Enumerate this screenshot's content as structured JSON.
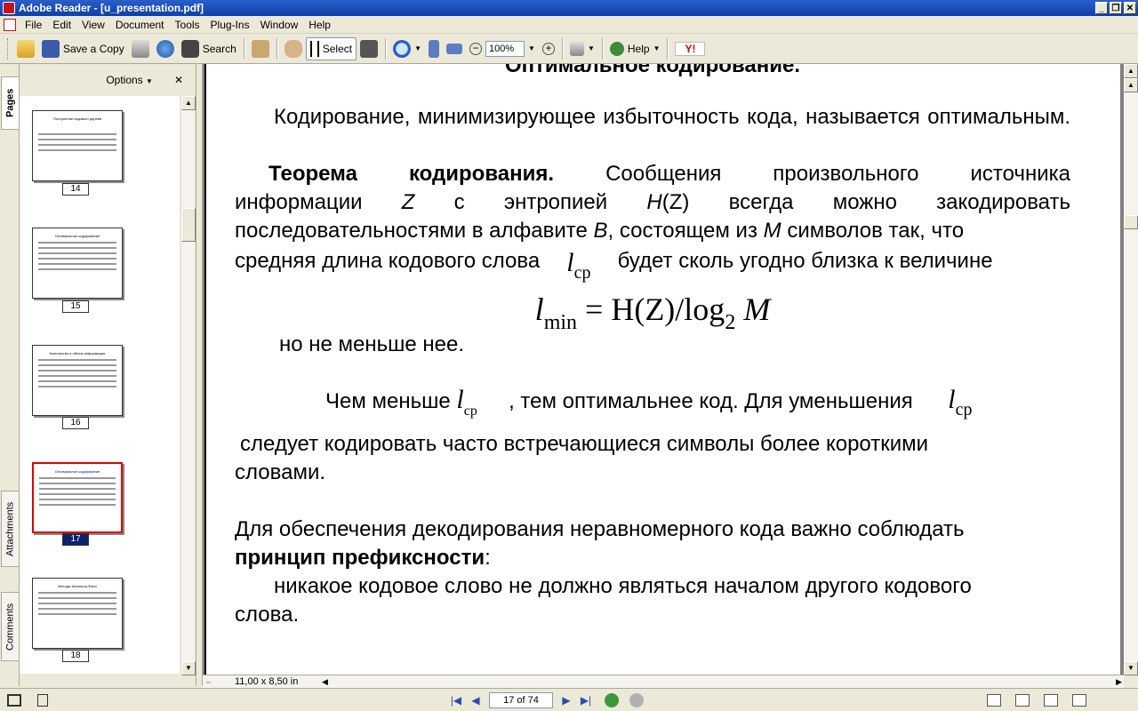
{
  "window": {
    "title": "Adobe Reader - [u_presentation.pdf]",
    "min": "_",
    "restore": "❐",
    "close": "✕"
  },
  "menu": {
    "items": [
      "File",
      "Edit",
      "View",
      "Document",
      "Tools",
      "Plug-Ins",
      "Window",
      "Help"
    ]
  },
  "toolbar": {
    "save_copy": "Save a Copy",
    "search": "Search",
    "select": "Select",
    "zoom_value": "100%",
    "help": "Help",
    "yahoo": "Y!"
  },
  "nav_tabs": {
    "pages": "Pages",
    "attachments": "Attachments",
    "comments": "Comments"
  },
  "pane": {
    "options": "Options",
    "close": "✕",
    "thumbnails": [
      {
        "num": "14",
        "title": "Построение кодового дерева"
      },
      {
        "num": "15",
        "title": "Оптимальное кодирование"
      },
      {
        "num": "16",
        "title": "Количество и объем информации"
      },
      {
        "num": "17",
        "title": "Оптимальное кодирование"
      },
      {
        "num": "18",
        "title": "Методы Шеннона-Фано"
      }
    ],
    "selected_page": "17"
  },
  "document": {
    "heading_partial": "Оптимальное кодирование.",
    "p1": "Кодирование, минимизирующее избыточность кода, называется оптимальным.",
    "theorem_bold": "Теорема кодирования.",
    "theorem_line1": "Сообщения произвольного источника",
    "theorem_line2_a": "информации",
    "theorem_Z": "Z",
    "theorem_line2_b": "с энтропией",
    "theorem_H": "H",
    "theorem_Zp": "(Z)",
    "theorem_line2_c": "всегда можно закодировать",
    "theorem_line3_a": "последовательностями в алфавите",
    "theorem_B": "B",
    "theorem_line3_b": ", состоящем из",
    "theorem_M": "M",
    "theorem_line3_c": "символов так, что",
    "theorem_line4_a": "средняя длина кодового слова",
    "l": "l",
    "cp": "ср",
    "theorem_line4_b": "будет сколь угодно близка к величине",
    "formula_l": "l",
    "formula_min": "min",
    "formula_eq": " = H(Z)/log",
    "formula_2": "2",
    "formula_M": " M",
    "but_not_less": "но не меньше нее.",
    "smaller_a": "Чем меньше",
    "smaller_b": ", тем оптимальнее код. Для уменьшения",
    "should_line1": "следует кодировать часто встречающиеся символы более короткими",
    "should_line2": "словами.",
    "decode_line1": "Для обеспечения декодирования неравномерного кода важно соблюдать",
    "prefix_bold": "принцип префиксности",
    "prefix_colon": ":",
    "never_line1": "никакое кодовое слово не должно являться началом другого кодового",
    "never_line2": "слова."
  },
  "bottom": {
    "page_size": "11,00 x 8,50 in",
    "page_field": "17 of 74"
  }
}
